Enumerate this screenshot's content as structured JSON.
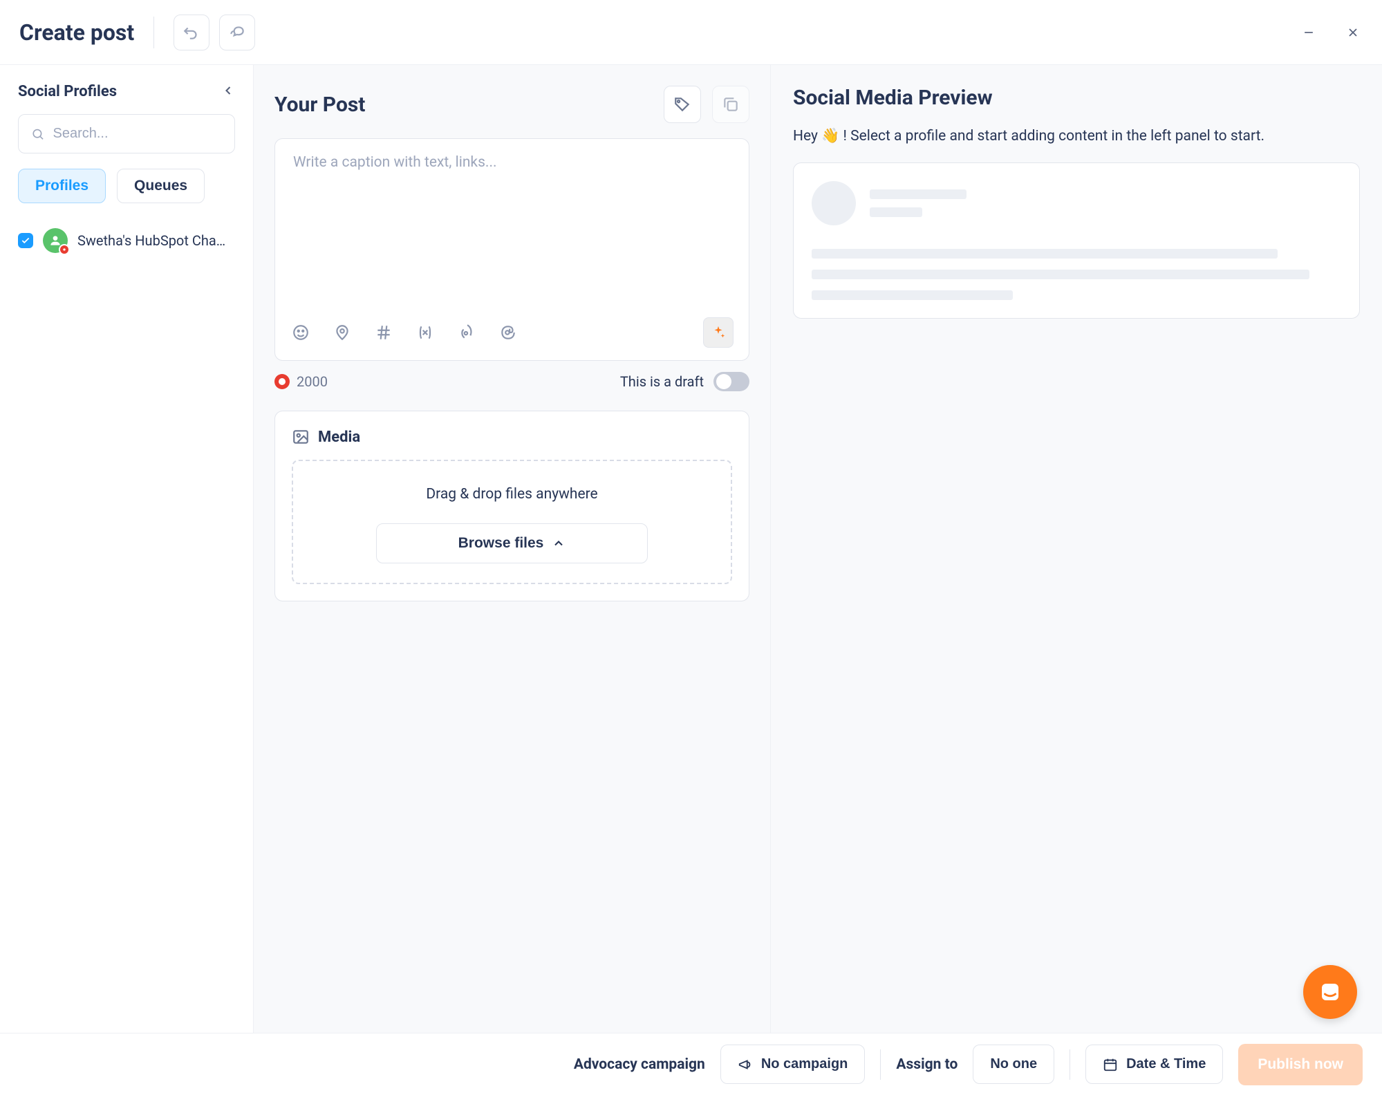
{
  "header": {
    "title": "Create post"
  },
  "sidebar": {
    "title": "Social Profiles",
    "search_placeholder": "Search...",
    "tabs": {
      "profiles": "Profiles",
      "queues": "Queues"
    },
    "profiles": [
      {
        "name": "Swetha's HubSpot Cha…",
        "checked": true
      }
    ]
  },
  "composer": {
    "title": "Your Post",
    "placeholder": "Write a caption with text, links...",
    "char_count": "2000",
    "draft_label": "This is a draft"
  },
  "media": {
    "title": "Media",
    "dropzone_text": "Drag & drop files anywhere",
    "browse_label": "Browse files"
  },
  "preview": {
    "title": "Social Media Preview",
    "hint_prefix": "Hey ",
    "hint_emoji": "👋",
    "hint_suffix": " ! Select a profile and start adding content in the left panel to start."
  },
  "footer": {
    "advocacy_label": "Advocacy campaign",
    "campaign_value": "No campaign",
    "assign_label": "Assign to",
    "assign_value": "No one",
    "datetime_label": "Date & Time",
    "publish_label": "Publish now"
  }
}
